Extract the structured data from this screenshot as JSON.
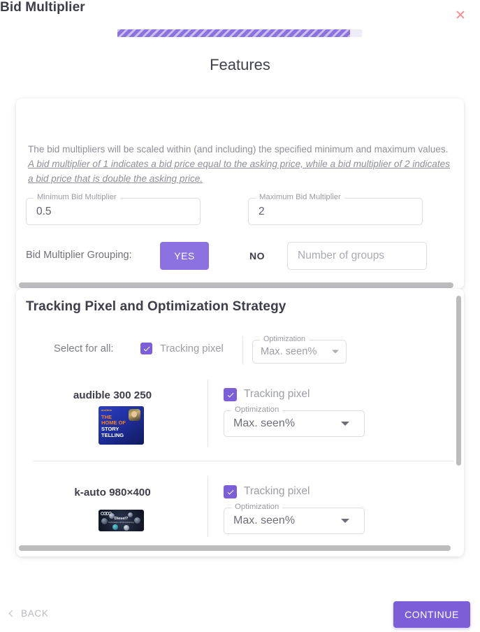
{
  "dialog": {
    "close_icon": "close-icon",
    "step_title": "Features",
    "progress_percent": 95
  },
  "bid_multiplier": {
    "title": "Bid Multiplier",
    "description_plain": "The bid multipliers will be scaled within (and including) the specified minimum and maximum values. ",
    "description_emphasis": "A bid multiplier of 1 indicates a bid price equal to the asking price, while a bid multiplier of 2 indicates a bid price that is double the asking price.",
    "min_field": {
      "label": "Minimum Bid Multiplier",
      "value": "0.5"
    },
    "max_field": {
      "label": "Maximum Bid Multiplier",
      "value": "2"
    },
    "grouping": {
      "label": "Bid Multiplier Grouping:",
      "yes_label": "YES",
      "no_label": "NO",
      "selected": "YES",
      "groups_placeholder": "Number of groups",
      "groups_value": ""
    }
  },
  "tracking": {
    "title": "Tracking Pixel and Optimization Strategy",
    "select_for_all": {
      "label": "Select for all:",
      "checkbox_label": "Tracking pixel",
      "checked": true,
      "optimization_label": "Optimization",
      "optimization_value": "Max. seen%"
    },
    "creatives": [
      {
        "name": "audible 300 250",
        "checkbox_label": "Tracking pixel",
        "checked": true,
        "optimization_label": "Optimization",
        "optimization_value": "Max. seen%",
        "thumb": {
          "kind": "audible",
          "logo": "audible",
          "line1": "THE",
          "line2": "HOME OF",
          "line3": "STORY",
          "line4": "TELLING"
        }
      },
      {
        "name": "k-auto 980×400",
        "checkbox_label": "Tracking pixel",
        "checked": true,
        "optimization_label": "Optimization",
        "optimization_value": "Max. seen%",
        "thumb": {
          "kind": "audi",
          "headline": "Diesel?",
          "subline": "Technologie und Verantwortung."
        }
      }
    ]
  },
  "footer": {
    "back_label": "BACK",
    "continue_label": "CONTINUE"
  },
  "colors": {
    "accent": "#7c5fd8",
    "progress": "#8b72e0",
    "close": "#f98a8f",
    "text_dark": "#3d3e49",
    "text_muted": "#9c9da6"
  }
}
